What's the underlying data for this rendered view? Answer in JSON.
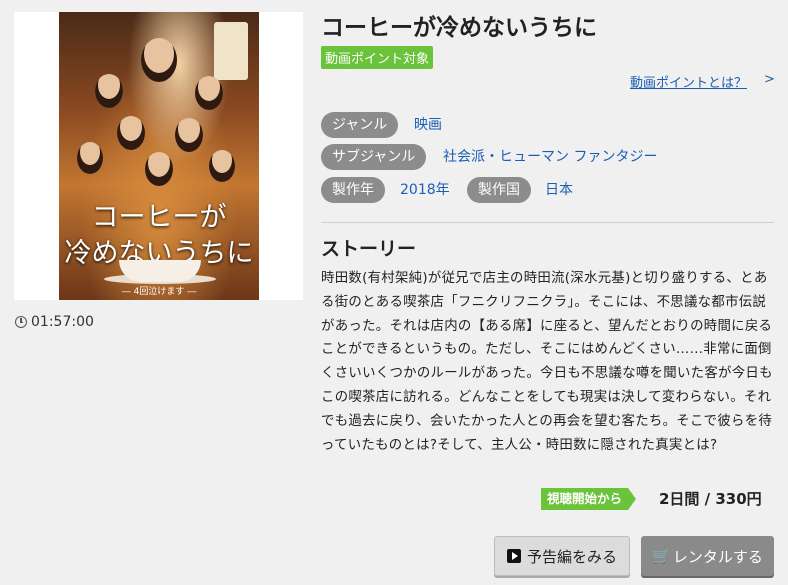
{
  "poster": {
    "title_line1": "コーヒーが",
    "title_line2": "冷めないうちに",
    "tagline": "― 4回泣けます ―"
  },
  "duration": "01:57:00",
  "title": "コーヒーが冷めないうちに",
  "point_tag": "動画ポイント対象",
  "point_help_link": "動画ポイントとは？",
  "point_help_arrow": ">",
  "meta": {
    "genre_label": "ジャンル",
    "genre_value": "映画",
    "subgenre_label": "サブジャンル",
    "subgenre_value": "社会派・ヒューマン ファンタジー",
    "year_label": "製作年",
    "year_value": "2018年",
    "country_label": "製作国",
    "country_value": "日本"
  },
  "story": {
    "heading": "ストーリー",
    "text": "時田数(有村架純)が従兄で店主の時田流(深水元基)と切り盛りする、とある街のとある喫茶店「フニクリフニクラ」。そこには、不思議な都市伝説があった。それは店内の【ある席】に座ると、望んだとおりの時間に戻ることができるというもの。ただし、そこにはめんどくさい……非常に面倒くさいいくつかのルールがあった。今日も不思議な噂を聞いた客が今日もこの喫茶店に訪れる。どんなことをしても現実は決して変わらない。それでも過去に戻り、会いたかった人との再会を望む客たち。そこで彼らを待っていたものとは?そして、主人公・時田数に隠された真実とは?"
  },
  "rental": {
    "badge": "視聴開始から",
    "price": "2日間 / 330円"
  },
  "buttons": {
    "trailer": "予告編をみる",
    "rental": "レンタルする"
  },
  "colors": {
    "accent_green": "#6ac33a",
    "link_blue": "#1a5fb4",
    "pill_gray": "#8c8c8c"
  }
}
